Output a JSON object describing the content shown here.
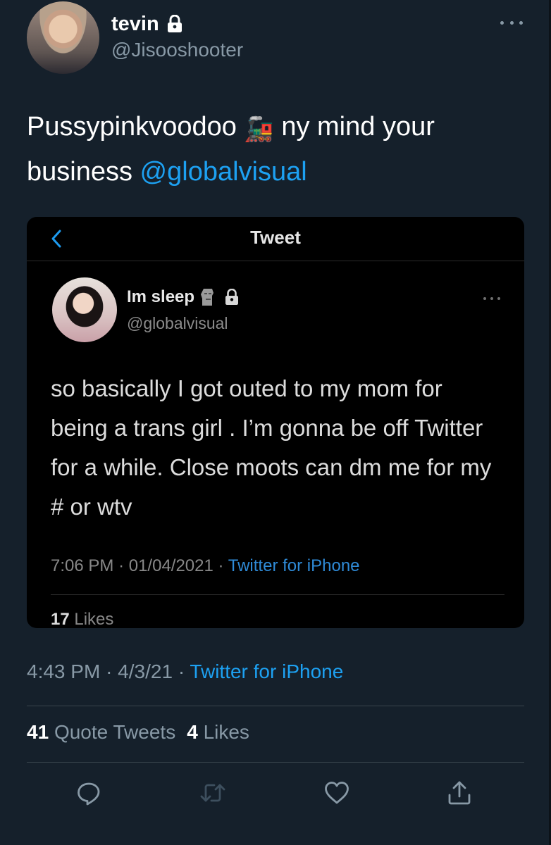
{
  "author": {
    "display_name": "tevin",
    "handle": "@Jisooshooter",
    "protected_icon": "lock-icon"
  },
  "tweet": {
    "text_before": "Pussypinkvoodoo",
    "emoji": "🚂",
    "text_after": "ny mind your business",
    "mention": "@globalvisual"
  },
  "embedded": {
    "header_title": "Tweet",
    "back_icon": "chevron-left-icon",
    "display_name": "Im sleep",
    "name_emoji_icon": "moai-icon",
    "handle": "@globalvisual",
    "text": "so basically I got outed to my mom for being a trans girl . I’m gonna be off Twitter for a while. Close moots can dm me for my # or wtv",
    "time": "7:06 PM",
    "date": "01/04/2021",
    "source": "Twitter for iPhone",
    "likes_count": "17",
    "likes_label": "Likes"
  },
  "meta": {
    "time": "4:43 PM",
    "date": "4/3/21",
    "separator": "·",
    "source": "Twitter for iPhone"
  },
  "stats": {
    "quote_count": "41",
    "quote_label": "Quote Tweets",
    "likes_count": "4",
    "likes_label": "Likes"
  },
  "actions": [
    "reply-icon",
    "retweet-icon",
    "like-icon",
    "share-icon"
  ],
  "colors": {
    "background": "#15202b",
    "accent": "#1da1f2",
    "muted": "#8899a6",
    "embed_background": "#000000"
  }
}
